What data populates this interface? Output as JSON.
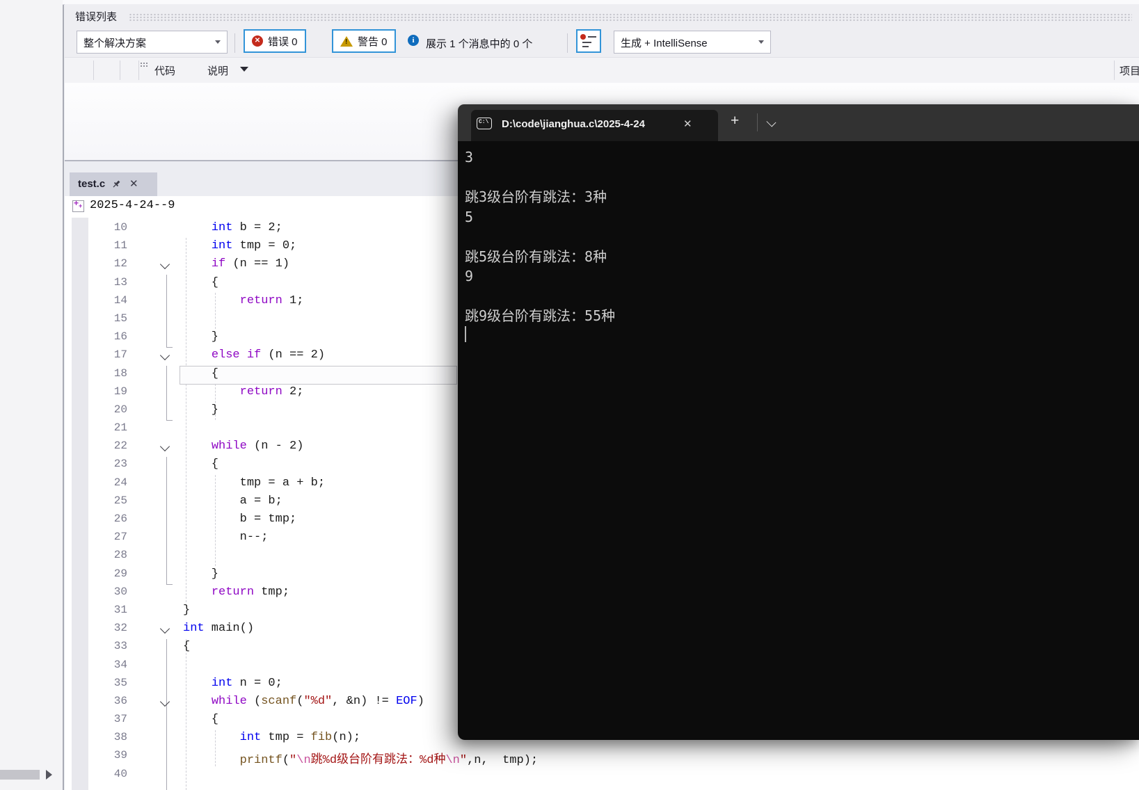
{
  "error_list": {
    "title": "错误列表",
    "scope_filter": "整个解决方案",
    "errors_button": "错误 0",
    "warnings_button": "警告 0",
    "messages_info": "展示 1 个消息中的 0 个",
    "source_filter": "生成 + IntelliSense",
    "columns": {
      "code": "代码",
      "description": "说明",
      "project": "项目"
    }
  },
  "editor": {
    "tab_label": "test.c",
    "collapsed_region_label": "2025-4-24--9",
    "code_lines": [
      {
        "n": 10,
        "chevron": false,
        "current": false,
        "segments": [
          [
            "    ",
            "pl"
          ],
          [
            "int",
            "kw"
          ],
          [
            " b = 2;",
            "pl"
          ]
        ]
      },
      {
        "n": 11,
        "chevron": false,
        "current": false,
        "segments": [
          [
            "    ",
            "pl"
          ],
          [
            "int",
            "kw"
          ],
          [
            " tmp = 0;",
            "pl"
          ]
        ]
      },
      {
        "n": 12,
        "chevron": true,
        "current": false,
        "segments": [
          [
            "    ",
            "pl"
          ],
          [
            "if",
            "ctrl"
          ],
          [
            " (n == 1)",
            "pl"
          ]
        ]
      },
      {
        "n": 13,
        "chevron": false,
        "current": false,
        "segments": [
          [
            "    {",
            "pl"
          ]
        ]
      },
      {
        "n": 14,
        "chevron": false,
        "current": false,
        "segments": [
          [
            "        ",
            "pl"
          ],
          [
            "return",
            "ctrl"
          ],
          [
            " 1;",
            "pl"
          ]
        ]
      },
      {
        "n": 15,
        "chevron": false,
        "current": false,
        "segments": []
      },
      {
        "n": 16,
        "chevron": false,
        "current": false,
        "segments": [
          [
            "    }",
            "pl"
          ]
        ]
      },
      {
        "n": 17,
        "chevron": true,
        "current": false,
        "segments": [
          [
            "    ",
            "pl"
          ],
          [
            "else",
            "ctrl"
          ],
          [
            " ",
            "pl"
          ],
          [
            "if",
            "ctrl"
          ],
          [
            " (n == 2)",
            "pl"
          ]
        ]
      },
      {
        "n": 18,
        "chevron": false,
        "current": true,
        "segments": [
          [
            "    {",
            "pl"
          ]
        ]
      },
      {
        "n": 19,
        "chevron": false,
        "current": false,
        "segments": [
          [
            "        ",
            "pl"
          ],
          [
            "return",
            "ctrl"
          ],
          [
            " 2;",
            "pl"
          ]
        ]
      },
      {
        "n": 20,
        "chevron": false,
        "current": false,
        "segments": [
          [
            "    }",
            "pl"
          ]
        ]
      },
      {
        "n": 21,
        "chevron": false,
        "current": false,
        "segments": []
      },
      {
        "n": 22,
        "chevron": true,
        "current": false,
        "segments": [
          [
            "    ",
            "pl"
          ],
          [
            "while",
            "ctrl"
          ],
          [
            " (n - 2)",
            "pl"
          ]
        ]
      },
      {
        "n": 23,
        "chevron": false,
        "current": false,
        "segments": [
          [
            "    {",
            "pl"
          ]
        ]
      },
      {
        "n": 24,
        "chevron": false,
        "current": false,
        "segments": [
          [
            "        tmp = a + b;",
            "pl"
          ]
        ]
      },
      {
        "n": 25,
        "chevron": false,
        "current": false,
        "segments": [
          [
            "        a = b;",
            "pl"
          ]
        ]
      },
      {
        "n": 26,
        "chevron": false,
        "current": false,
        "segments": [
          [
            "        b = tmp;",
            "pl"
          ]
        ]
      },
      {
        "n": 27,
        "chevron": false,
        "current": false,
        "segments": [
          [
            "        n--;",
            "pl"
          ]
        ]
      },
      {
        "n": 28,
        "chevron": false,
        "current": false,
        "segments": []
      },
      {
        "n": 29,
        "chevron": false,
        "current": false,
        "segments": [
          [
            "    }",
            "pl"
          ]
        ]
      },
      {
        "n": 30,
        "chevron": false,
        "current": false,
        "segments": [
          [
            "    ",
            "pl"
          ],
          [
            "return",
            "ctrl"
          ],
          [
            " tmp;",
            "pl"
          ]
        ]
      },
      {
        "n": 31,
        "chevron": false,
        "current": false,
        "segments": [
          [
            "}",
            "pl"
          ]
        ]
      },
      {
        "n": 32,
        "chevron": true,
        "current": false,
        "segments": [
          [
            "int",
            "kw"
          ],
          [
            " main()",
            "pl"
          ]
        ]
      },
      {
        "n": 33,
        "chevron": false,
        "current": false,
        "segments": [
          [
            "{",
            "pl"
          ]
        ]
      },
      {
        "n": 34,
        "chevron": false,
        "current": false,
        "segments": []
      },
      {
        "n": 35,
        "chevron": false,
        "current": false,
        "segments": [
          [
            "    ",
            "pl"
          ],
          [
            "int",
            "kw"
          ],
          [
            " n = 0;",
            "pl"
          ]
        ]
      },
      {
        "n": 36,
        "chevron": true,
        "current": false,
        "segments": [
          [
            "    ",
            "pl"
          ],
          [
            "while",
            "ctrl"
          ],
          [
            " (",
            "pl"
          ],
          [
            "scanf",
            "fn"
          ],
          [
            "(",
            "pl"
          ],
          [
            "\"%d\"",
            "str"
          ],
          [
            ", &n) != ",
            "pl"
          ],
          [
            "EOF",
            "kw"
          ],
          [
            ")",
            "pl"
          ]
        ]
      },
      {
        "n": 37,
        "chevron": false,
        "current": false,
        "segments": [
          [
            "    {",
            "pl"
          ]
        ]
      },
      {
        "n": 38,
        "chevron": false,
        "current": false,
        "segments": [
          [
            "        ",
            "pl"
          ],
          [
            "int",
            "kw"
          ],
          [
            " tmp = ",
            "pl"
          ],
          [
            "fib",
            "fn"
          ],
          [
            "(n);",
            "pl"
          ]
        ]
      },
      {
        "n": 39,
        "chevron": false,
        "current": false,
        "segments": [
          [
            "        ",
            "pl"
          ],
          [
            "printf",
            "fn"
          ],
          [
            "(",
            "pl"
          ],
          [
            "\"",
            "str"
          ],
          [
            "\\n",
            "esc"
          ],
          [
            "跳%d级台阶有跳法：%d种",
            "str"
          ],
          [
            "\\n",
            "esc"
          ],
          [
            "\"",
            "str"
          ],
          [
            ",n,  tmp);",
            "pl"
          ]
        ]
      },
      {
        "n": 40,
        "chevron": false,
        "current": false,
        "segments": []
      }
    ]
  },
  "terminal": {
    "tab_title": "D:\\code\\jianghua.c\\2025-4-24",
    "new_tab_label": "+",
    "output_lines": [
      "3",
      "",
      "跳3级台阶有跳法：3种",
      "5",
      "",
      "跳5级台阶有跳法：8种",
      "9",
      "",
      "跳9级台阶有跳法：55种"
    ]
  },
  "colors": {
    "keyword": "#0000ee",
    "control_keyword": "#8f08c4",
    "function": "#74531f",
    "string": "#a31515",
    "string_escape": "#c9539d",
    "plain_code": "#1b1b1b",
    "accent_blue": "#3294d8",
    "error_red": "#c42b1c",
    "warning_amber": "#c79a02",
    "info_blue": "#0f6cbd",
    "terminal_bg": "#0c0c0c"
  }
}
